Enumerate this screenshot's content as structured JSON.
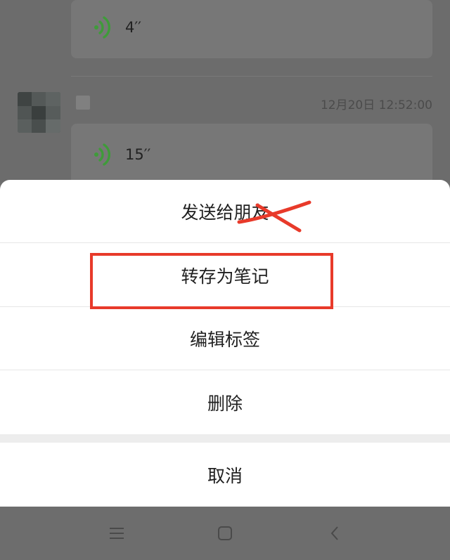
{
  "messages": [
    {
      "duration": "4′′"
    },
    {
      "timestamp": "12月20日 12:52:00",
      "duration": "15′′"
    }
  ],
  "action_sheet": {
    "items": [
      {
        "label": "发送给朋友"
      },
      {
        "label": "转存为笔记"
      },
      {
        "label": "编辑标签"
      },
      {
        "label": "删除"
      }
    ],
    "cancel_label": "取消"
  },
  "annotation_color": "#e83a2a",
  "voice_icon_color": "#3f9b3a",
  "icons": [
    "voice-wave-icon",
    "menu-icon",
    "home-icon",
    "back-icon"
  ]
}
